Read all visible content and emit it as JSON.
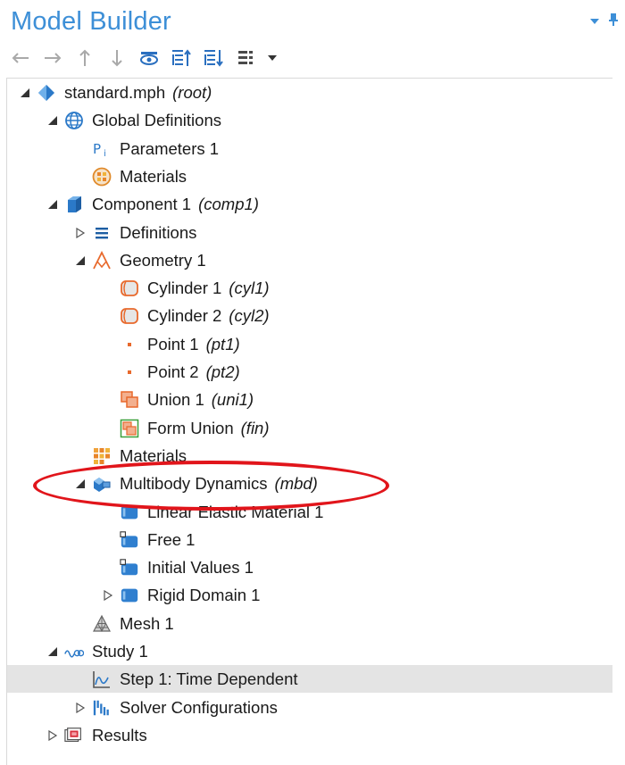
{
  "panel": {
    "title": "Model Builder",
    "toolbar_icons": [
      "arrow-left-icon",
      "arrow-right-icon",
      "arrow-up-icon",
      "arrow-down-icon",
      "eye-icon",
      "expand-all-icon",
      "collapse-all-icon",
      "list-settings-icon",
      "dropdown-icon"
    ],
    "header_icons": [
      "panel-menu-icon",
      "pin-icon"
    ]
  },
  "tree": [
    {
      "label": "standard.mph",
      "tag": "(root)",
      "level": 0,
      "toggle": "expanded",
      "icon": "root-model-icon",
      "selected": false
    },
    {
      "label": "Global Definitions",
      "tag": "",
      "level": 1,
      "toggle": "expanded",
      "icon": "globe-icon",
      "selected": false
    },
    {
      "label": "Parameters 1",
      "tag": "",
      "level": 2,
      "toggle": "none",
      "icon": "parameters-icon",
      "selected": false
    },
    {
      "label": "Materials",
      "tag": "",
      "level": 2,
      "toggle": "none",
      "icon": "global-materials-icon",
      "selected": false
    },
    {
      "label": "Component 1",
      "tag": "(comp1)",
      "level": 1,
      "toggle": "expanded",
      "icon": "component-icon",
      "selected": false
    },
    {
      "label": "Definitions",
      "tag": "",
      "level": 2,
      "toggle": "collapsed",
      "icon": "definitions-icon",
      "selected": false
    },
    {
      "label": "Geometry 1",
      "tag": "",
      "level": 2,
      "toggle": "expanded",
      "icon": "geometry-icon",
      "selected": false
    },
    {
      "label": "Cylinder 1",
      "tag": "(cyl1)",
      "level": 3,
      "toggle": "none",
      "icon": "cylinder-icon",
      "selected": false
    },
    {
      "label": "Cylinder 2",
      "tag": "(cyl2)",
      "level": 3,
      "toggle": "none",
      "icon": "cylinder-icon",
      "selected": false
    },
    {
      "label": "Point 1",
      "tag": "(pt1)",
      "level": 3,
      "toggle": "none",
      "icon": "point-icon",
      "selected": false
    },
    {
      "label": "Point 2",
      "tag": "(pt2)",
      "level": 3,
      "toggle": "none",
      "icon": "point-icon",
      "selected": false
    },
    {
      "label": "Union 1",
      "tag": "(uni1)",
      "level": 3,
      "toggle": "none",
      "icon": "union-icon",
      "selected": false
    },
    {
      "label": "Form Union",
      "tag": "(fin)",
      "level": 3,
      "toggle": "none",
      "icon": "form-union-icon",
      "selected": false
    },
    {
      "label": "Materials",
      "tag": "",
      "level": 2,
      "toggle": "none",
      "icon": "materials-icon",
      "selected": false
    },
    {
      "label": "Multibody Dynamics",
      "tag": "(mbd)",
      "level": 2,
      "toggle": "expanded",
      "icon": "multibody-dynamics-icon",
      "selected": false
    },
    {
      "label": "Linear Elastic Material 1",
      "tag": "",
      "level": 3,
      "toggle": "none",
      "icon": "physics-feature-icon",
      "selected": false
    },
    {
      "label": "Free 1",
      "tag": "",
      "level": 3,
      "toggle": "none",
      "icon": "physics-feature-default-icon",
      "selected": false
    },
    {
      "label": "Initial Values 1",
      "tag": "",
      "level": 3,
      "toggle": "none",
      "icon": "physics-feature-default-icon",
      "selected": false
    },
    {
      "label": "Rigid Domain 1",
      "tag": "",
      "level": 3,
      "toggle": "collapsed",
      "icon": "physics-feature-icon",
      "selected": false
    },
    {
      "label": "Mesh 1",
      "tag": "",
      "level": 2,
      "toggle": "none",
      "icon": "mesh-icon",
      "selected": false
    },
    {
      "label": "Study 1",
      "tag": "",
      "level": 1,
      "toggle": "expanded",
      "icon": "study-icon",
      "selected": false
    },
    {
      "label": "Step 1: Time Dependent",
      "tag": "",
      "level": 2,
      "toggle": "none",
      "icon": "time-dependent-icon",
      "selected": true
    },
    {
      "label": "Solver Configurations",
      "tag": "",
      "level": 2,
      "toggle": "collapsed",
      "icon": "solver-configurations-icon",
      "selected": false
    },
    {
      "label": "Results",
      "tag": "",
      "level": 1,
      "toggle": "collapsed",
      "icon": "results-icon",
      "selected": false
    }
  ],
  "colors": {
    "title": "#3d8fd7",
    "selection": "#e4e4e4",
    "highlight_ring": "#e1151b",
    "geometry_orange": "#e8692c",
    "physics_blue": "#2f7fcf"
  }
}
